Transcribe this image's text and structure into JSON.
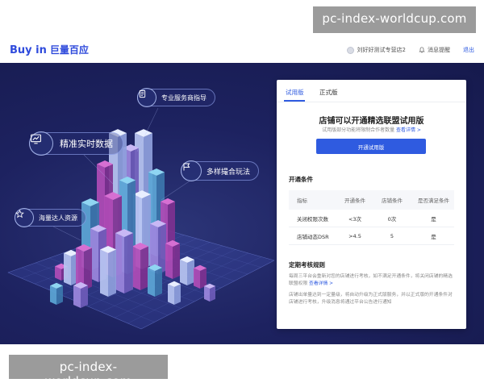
{
  "watermark": {
    "top": "pc-index-worldcup.com",
    "bottom": "pc-index-worldcup.com"
  },
  "header": {
    "logo_en": "Buy in",
    "logo_cn": "巨量百应",
    "store_name": "刘好好测试专营店2",
    "message_label": "消息提醒",
    "logout_label": "退出"
  },
  "features": [
    {
      "label": "专业服务商指导",
      "icon": "document-icon"
    },
    {
      "label": "精准实时数据",
      "icon": "chart-icon"
    },
    {
      "label": "多样撮合玩法",
      "icon": "flag-icon"
    },
    {
      "label": "海量达人资源",
      "icon": "star-icon"
    }
  ],
  "card": {
    "tabs": [
      "试用版",
      "正式版"
    ],
    "title": "店铺可以开通精选联盟试用版",
    "subtitle": "试用版部分功能将限制合作者数量",
    "subtitle_link": "查看详情 >",
    "open_button": "开通试用版",
    "conditions_title": "开通条件",
    "table": {
      "headers": [
        "指标",
        "开通条件",
        "店铺条件",
        "是否满足条件"
      ],
      "rows": [
        [
          "关闭权限次数",
          "<3次",
          "0次",
          "是"
        ],
        [
          "店铺动态DSR",
          ">4.5",
          "5",
          "是"
        ]
      ]
    },
    "rule_title": "定期考核规则",
    "rule_text_1": "每周三平台会重新对您的店铺进行考核，如不满足开通条件，将关闭店铺的精选联盟权限",
    "rule_link": "查看详情 >",
    "rule_text_2": "店铺出单量达到一定量级，将自动升级为正式版服务，并以正式版的开通条件对店铺进行考核，升级消息将通过平台公告进行通知"
  },
  "colors": {
    "brand": "#2f5be0",
    "hero_bg": "#1d2260"
  }
}
